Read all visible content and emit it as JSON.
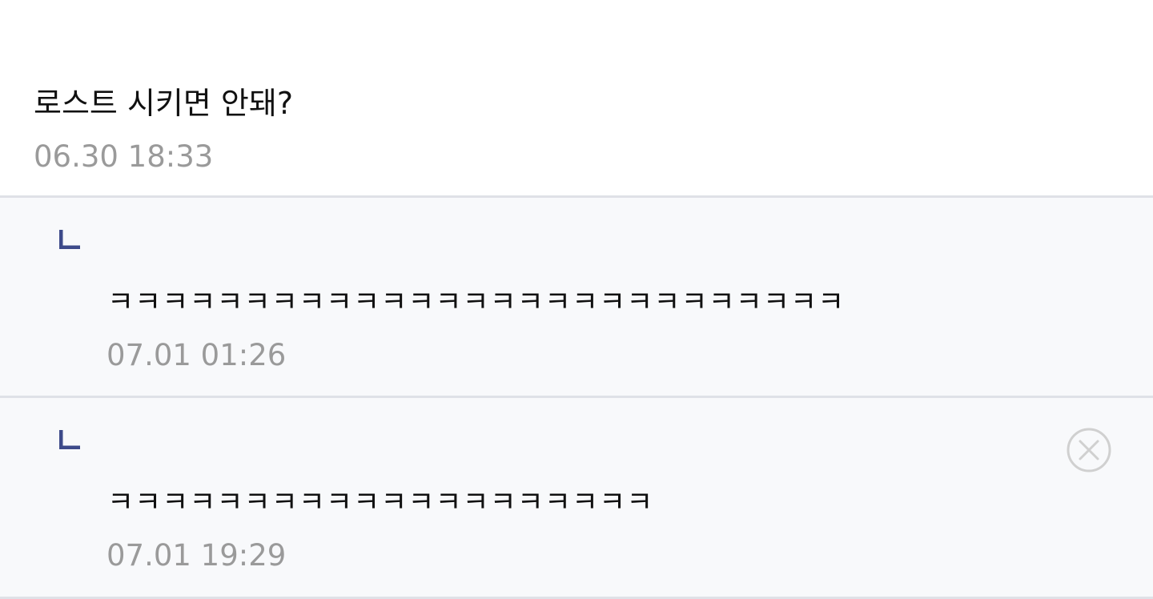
{
  "post": {
    "text": "로스트 시키면 안돼?",
    "time": "06.30 18:33"
  },
  "replies": [
    {
      "text": "ㅋㅋㅋㅋㅋㅋㅋㅋㅋㅋㅋㅋㅋㅋㅋㅋㅋㅋㅋㅋㅋㅋㅋㅋㅋㅋㅋ",
      "time": "07.01 01:26",
      "has_delete": false
    },
    {
      "text": "ㅋㅋㅋㅋㅋㅋㅋㅋㅋㅋㅋㅋㅋㅋㅋㅋㅋㅋㅋㅋ",
      "time": "07.01 19:29",
      "has_delete": true
    }
  ],
  "icons": {
    "reply": "reply-arrow-icon",
    "delete": "close-circle-icon"
  },
  "colors": {
    "reply_arrow": "#3d4a8a",
    "timestamp": "#9a9a9a",
    "reply_background": "#f8f9fb",
    "divider": "#dfe1e7",
    "delete_icon": "#d0d0d0"
  }
}
